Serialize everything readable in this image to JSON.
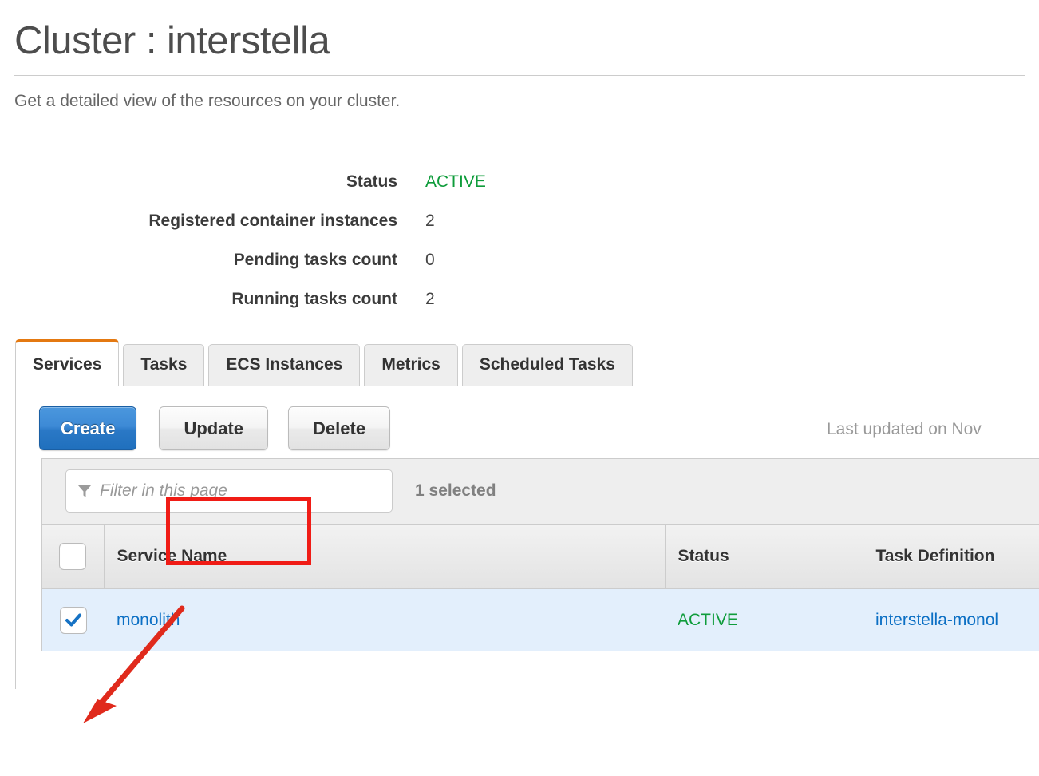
{
  "page": {
    "title": "Cluster : interstella",
    "subtitle": "Get a detailed view of the resources on your cluster."
  },
  "details": [
    {
      "label": "Status",
      "value": "ACTIVE",
      "value_color": "#0f9c3b"
    },
    {
      "label": "Registered container instances",
      "value": "2"
    },
    {
      "label": "Pending tasks count",
      "value": "0"
    },
    {
      "label": "Running tasks count",
      "value": "2"
    }
  ],
  "tabs": [
    {
      "label": "Services",
      "active": true
    },
    {
      "label": "Tasks",
      "active": false
    },
    {
      "label": "ECS Instances",
      "active": false
    },
    {
      "label": "Metrics",
      "active": false
    },
    {
      "label": "Scheduled Tasks",
      "active": false
    }
  ],
  "toolbar": {
    "create_label": "Create",
    "update_label": "Update",
    "delete_label": "Delete",
    "last_updated": "Last updated on Nov"
  },
  "filter": {
    "value": "",
    "placeholder": "Filter in this page",
    "icon": "filter-icon",
    "selected_count_label": "1 selected"
  },
  "table": {
    "columns": [
      "",
      "Service Name",
      "Status",
      "Task Definition"
    ],
    "rows": [
      {
        "checked": true,
        "service_name": "monolith",
        "status": "ACTIVE",
        "task_definition": "interstella-monol"
      }
    ]
  },
  "annotations": {
    "highlight_box_color": "#f01c16",
    "arrow_color": "#e02a1c",
    "arrow_from_label": "update-button-area",
    "arrow_to_label": "row-checkbox"
  },
  "colors": {
    "accent_orange": "#e47911",
    "link_blue": "#0b6fc4",
    "status_green": "#0f9c3b",
    "selected_row_blue": "#e3effc",
    "primary_button_blue": "#2a78c6"
  }
}
